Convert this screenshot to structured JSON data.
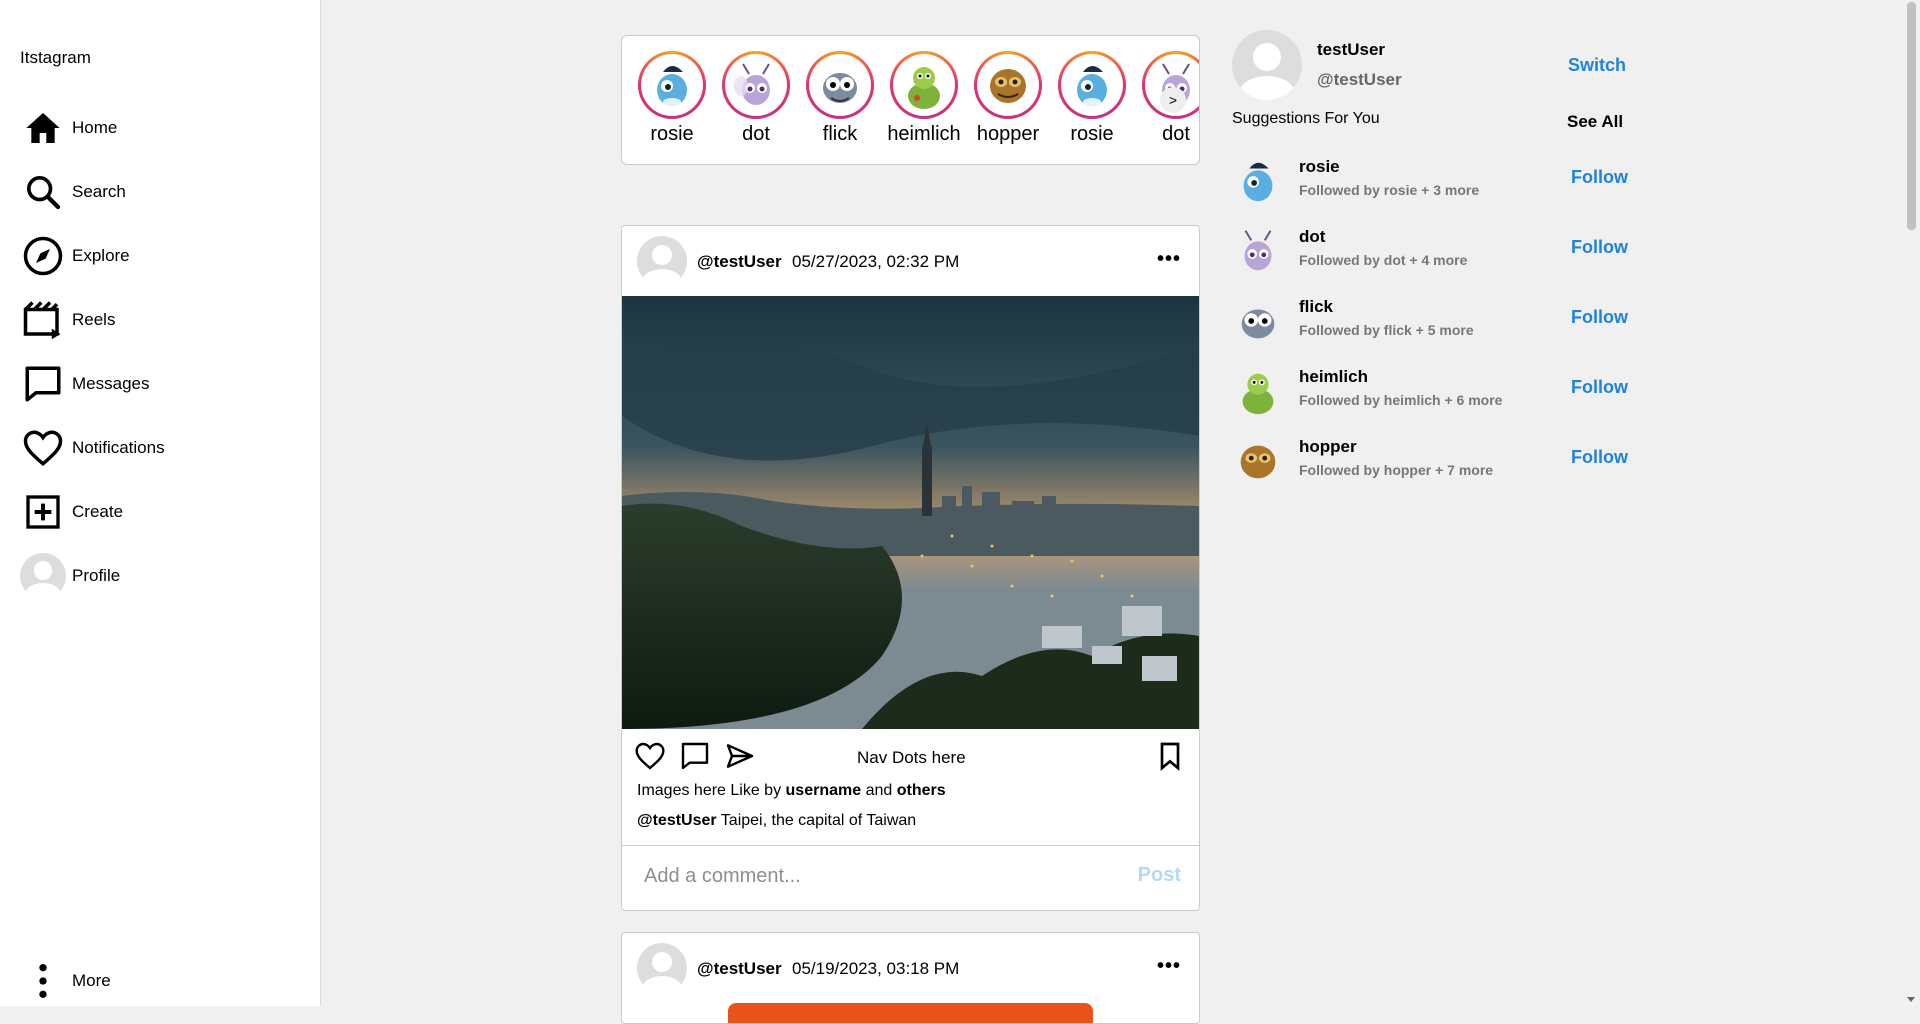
{
  "app": {
    "logo": "Itstagram"
  },
  "nav": {
    "home": "Home",
    "search": "Search",
    "explore": "Explore",
    "reels": "Reels",
    "messages": "Messages",
    "notifications": "Notifications",
    "create": "Create",
    "profile": "Profile",
    "more": "More"
  },
  "stories": [
    {
      "name": "rosie",
      "character": "blue-bug"
    },
    {
      "name": "dot",
      "character": "purple-ant"
    },
    {
      "name": "flick",
      "character": "gray-ant"
    },
    {
      "name": "heimlich",
      "character": "green-caterpillar"
    },
    {
      "name": "hopper",
      "character": "brown-grasshopper"
    },
    {
      "name": "rosie",
      "character": "blue-bug"
    },
    {
      "name": "dot",
      "character": "purple-ant"
    }
  ],
  "stories_next": ">",
  "posts": [
    {
      "user": "@testUser",
      "date": "05/27/2023, 02:32 PM",
      "more": "•••",
      "nav_dots": "Nav Dots here",
      "likes_prefix": "Images here  Like by",
      "likes_user": "username",
      "likes_and": "and",
      "likes_others": "others",
      "caption_user": "@testUser",
      "caption": "Taipei, the capital of Taiwan",
      "comment_placeholder": "Add a comment...",
      "post_label": "Post"
    },
    {
      "user": "@testUser",
      "date": "05/19/2023, 03:18 PM",
      "more": "•••"
    }
  ],
  "me": {
    "name": "testUser",
    "handle": "@testUser",
    "switch": "Switch"
  },
  "suggestions_title": "Suggestions For You",
  "see_all": "See All",
  "suggestions": [
    {
      "name": "rosie",
      "by": "Followed by rosie + 3 more",
      "follow": "Follow"
    },
    {
      "name": "dot",
      "by": "Followed by dot + 4 more",
      "follow": "Follow"
    },
    {
      "name": "flick",
      "by": "Followed by flick + 5 more",
      "follow": "Follow"
    },
    {
      "name": "heimlich",
      "by": "Followed by heimlich + 6 more",
      "follow": "Follow"
    },
    {
      "name": "hopper",
      "by": "Followed by hopper + 7 more",
      "follow": "Follow"
    }
  ],
  "colors": {
    "accent": "#1f82e0",
    "post_disabled": "#b3d9f7",
    "background": "#f0f0f0"
  }
}
